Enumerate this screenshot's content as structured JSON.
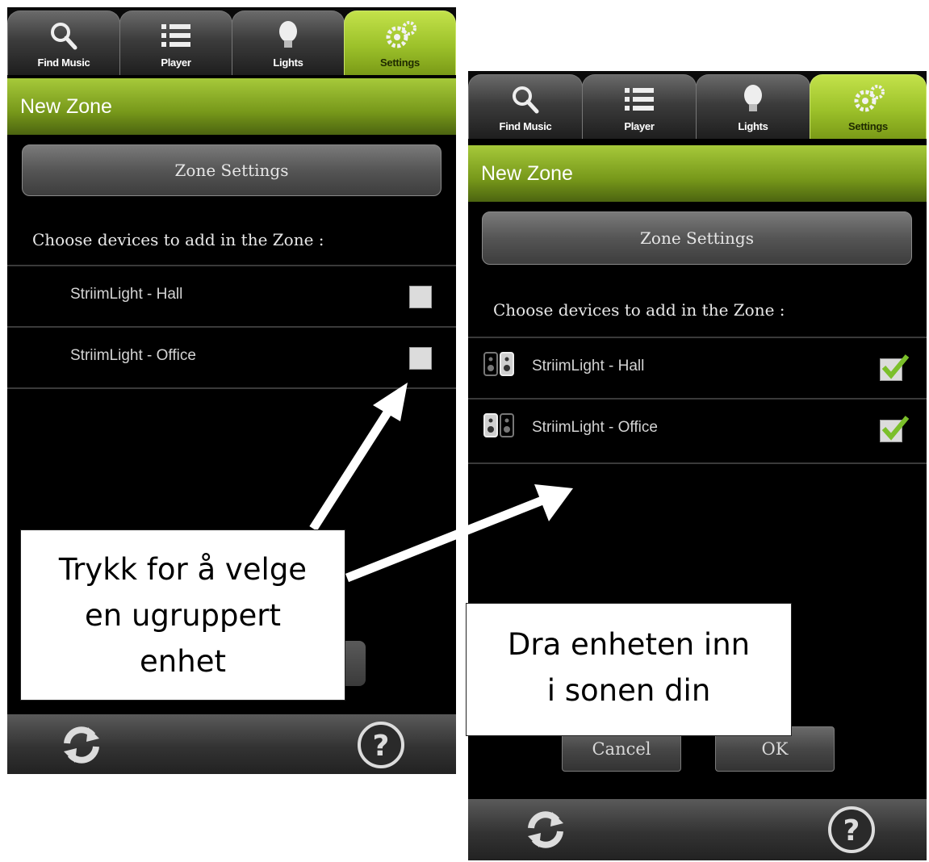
{
  "tabs": [
    {
      "label": "Find Music",
      "icon": "search-icon",
      "active": false
    },
    {
      "label": "Player",
      "icon": "list-icon",
      "active": false
    },
    {
      "label": "Lights",
      "icon": "lightbulb-icon",
      "active": false
    },
    {
      "label": "Settings",
      "icon": "gears-icon",
      "active": true
    }
  ],
  "screen_title": "New Zone",
  "zone_settings_label": "Zone Settings",
  "prompt": "Choose devices to add in the Zone :",
  "devices": [
    {
      "label": "StriimLight - Hall"
    },
    {
      "label": "StriimLight - Office"
    }
  ],
  "left_checked": [
    false,
    false
  ],
  "right_checked": [
    true,
    true
  ],
  "dialog": {
    "cancel_label": "Cancel",
    "ok_label": "OK"
  },
  "bottom_icons": [
    "refresh-icon",
    "help-icon"
  ],
  "callouts": {
    "left": [
      "Trykk for å velge",
      "en ugruppert",
      "enhet"
    ],
    "right": [
      "Dra enheten inn",
      "i sonen din"
    ]
  },
  "colors": {
    "accent_green": "#9cc12a",
    "background": "#000000",
    "callout_bg": "#ffffff"
  }
}
